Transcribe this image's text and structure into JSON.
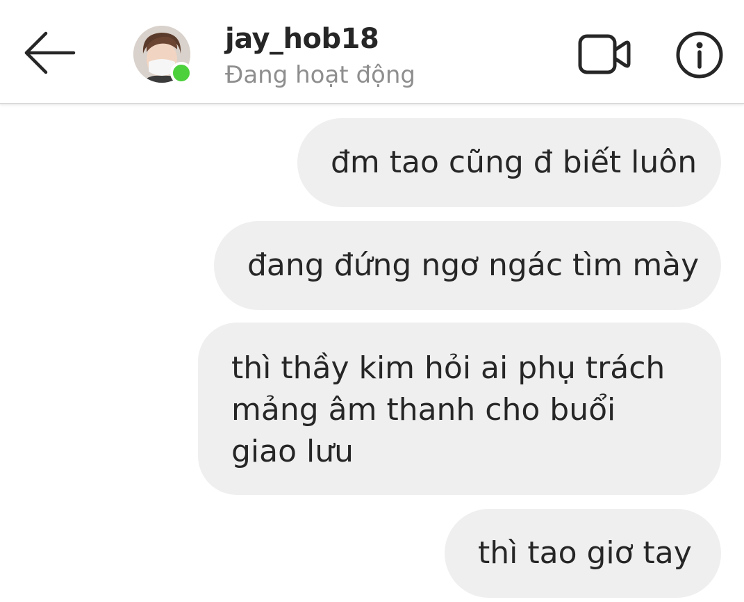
{
  "header": {
    "username": "jay_hob18",
    "status": "Đang hoạt động",
    "back_icon": "arrow-left-icon",
    "video_icon": "video-camera-icon",
    "info_icon": "info-circle-icon",
    "online_color": "#4cd03b"
  },
  "messages": [
    {
      "text": "đm tao cũng đ biết luôn"
    },
    {
      "text": "đang đứng ngơ ngác tìm mày"
    },
    {
      "text": "thì thầy kim hỏi ai phụ trách mảng âm thanh cho buổi giao lưu"
    },
    {
      "text": "thì tao giơ tay"
    }
  ],
  "colors": {
    "bubble_bg": "#efefef",
    "text": "#262626",
    "secondary_text": "#8e8e8e"
  }
}
